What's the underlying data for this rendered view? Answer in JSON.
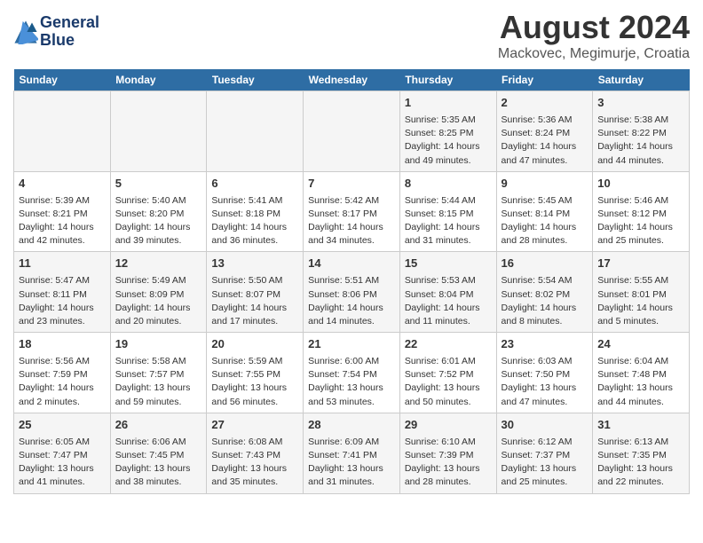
{
  "header": {
    "logo_line1": "General",
    "logo_line2": "Blue",
    "title": "August 2024",
    "subtitle": "Mackovec, Megimurje, Croatia"
  },
  "weekdays": [
    "Sunday",
    "Monday",
    "Tuesday",
    "Wednesday",
    "Thursday",
    "Friday",
    "Saturday"
  ],
  "weeks": [
    [
      {
        "day": "",
        "info": ""
      },
      {
        "day": "",
        "info": ""
      },
      {
        "day": "",
        "info": ""
      },
      {
        "day": "",
        "info": ""
      },
      {
        "day": "1",
        "info": "Sunrise: 5:35 AM\nSunset: 8:25 PM\nDaylight: 14 hours\nand 49 minutes."
      },
      {
        "day": "2",
        "info": "Sunrise: 5:36 AM\nSunset: 8:24 PM\nDaylight: 14 hours\nand 47 minutes."
      },
      {
        "day": "3",
        "info": "Sunrise: 5:38 AM\nSunset: 8:22 PM\nDaylight: 14 hours\nand 44 minutes."
      }
    ],
    [
      {
        "day": "4",
        "info": "Sunrise: 5:39 AM\nSunset: 8:21 PM\nDaylight: 14 hours\nand 42 minutes."
      },
      {
        "day": "5",
        "info": "Sunrise: 5:40 AM\nSunset: 8:20 PM\nDaylight: 14 hours\nand 39 minutes."
      },
      {
        "day": "6",
        "info": "Sunrise: 5:41 AM\nSunset: 8:18 PM\nDaylight: 14 hours\nand 36 minutes."
      },
      {
        "day": "7",
        "info": "Sunrise: 5:42 AM\nSunset: 8:17 PM\nDaylight: 14 hours\nand 34 minutes."
      },
      {
        "day": "8",
        "info": "Sunrise: 5:44 AM\nSunset: 8:15 PM\nDaylight: 14 hours\nand 31 minutes."
      },
      {
        "day": "9",
        "info": "Sunrise: 5:45 AM\nSunset: 8:14 PM\nDaylight: 14 hours\nand 28 minutes."
      },
      {
        "day": "10",
        "info": "Sunrise: 5:46 AM\nSunset: 8:12 PM\nDaylight: 14 hours\nand 25 minutes."
      }
    ],
    [
      {
        "day": "11",
        "info": "Sunrise: 5:47 AM\nSunset: 8:11 PM\nDaylight: 14 hours\nand 23 minutes."
      },
      {
        "day": "12",
        "info": "Sunrise: 5:49 AM\nSunset: 8:09 PM\nDaylight: 14 hours\nand 20 minutes."
      },
      {
        "day": "13",
        "info": "Sunrise: 5:50 AM\nSunset: 8:07 PM\nDaylight: 14 hours\nand 17 minutes."
      },
      {
        "day": "14",
        "info": "Sunrise: 5:51 AM\nSunset: 8:06 PM\nDaylight: 14 hours\nand 14 minutes."
      },
      {
        "day": "15",
        "info": "Sunrise: 5:53 AM\nSunset: 8:04 PM\nDaylight: 14 hours\nand 11 minutes."
      },
      {
        "day": "16",
        "info": "Sunrise: 5:54 AM\nSunset: 8:02 PM\nDaylight: 14 hours\nand 8 minutes."
      },
      {
        "day": "17",
        "info": "Sunrise: 5:55 AM\nSunset: 8:01 PM\nDaylight: 14 hours\nand 5 minutes."
      }
    ],
    [
      {
        "day": "18",
        "info": "Sunrise: 5:56 AM\nSunset: 7:59 PM\nDaylight: 14 hours\nand 2 minutes."
      },
      {
        "day": "19",
        "info": "Sunrise: 5:58 AM\nSunset: 7:57 PM\nDaylight: 13 hours\nand 59 minutes."
      },
      {
        "day": "20",
        "info": "Sunrise: 5:59 AM\nSunset: 7:55 PM\nDaylight: 13 hours\nand 56 minutes."
      },
      {
        "day": "21",
        "info": "Sunrise: 6:00 AM\nSunset: 7:54 PM\nDaylight: 13 hours\nand 53 minutes."
      },
      {
        "day": "22",
        "info": "Sunrise: 6:01 AM\nSunset: 7:52 PM\nDaylight: 13 hours\nand 50 minutes."
      },
      {
        "day": "23",
        "info": "Sunrise: 6:03 AM\nSunset: 7:50 PM\nDaylight: 13 hours\nand 47 minutes."
      },
      {
        "day": "24",
        "info": "Sunrise: 6:04 AM\nSunset: 7:48 PM\nDaylight: 13 hours\nand 44 minutes."
      }
    ],
    [
      {
        "day": "25",
        "info": "Sunrise: 6:05 AM\nSunset: 7:47 PM\nDaylight: 13 hours\nand 41 minutes."
      },
      {
        "day": "26",
        "info": "Sunrise: 6:06 AM\nSunset: 7:45 PM\nDaylight: 13 hours\nand 38 minutes."
      },
      {
        "day": "27",
        "info": "Sunrise: 6:08 AM\nSunset: 7:43 PM\nDaylight: 13 hours\nand 35 minutes."
      },
      {
        "day": "28",
        "info": "Sunrise: 6:09 AM\nSunset: 7:41 PM\nDaylight: 13 hours\nand 31 minutes."
      },
      {
        "day": "29",
        "info": "Sunrise: 6:10 AM\nSunset: 7:39 PM\nDaylight: 13 hours\nand 28 minutes."
      },
      {
        "day": "30",
        "info": "Sunrise: 6:12 AM\nSunset: 7:37 PM\nDaylight: 13 hours\nand 25 minutes."
      },
      {
        "day": "31",
        "info": "Sunrise: 6:13 AM\nSunset: 7:35 PM\nDaylight: 13 hours\nand 22 minutes."
      }
    ]
  ]
}
